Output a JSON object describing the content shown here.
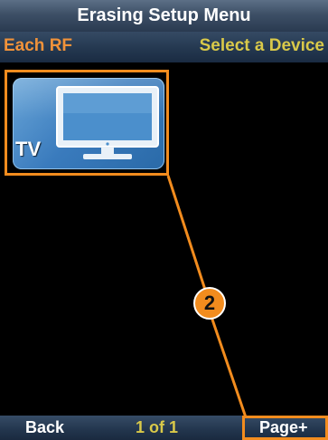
{
  "header": {
    "title": "Erasing Setup Menu"
  },
  "subheader": {
    "left_label": "Each RF",
    "right_label": "Select a Device"
  },
  "devices": [
    {
      "label": "TV",
      "icon": "tv-icon"
    }
  ],
  "footer": {
    "back_label": "Back",
    "page_indicator": "1 of 1",
    "page_next_label": "Page+"
  },
  "annotation": {
    "callout_number": "2"
  },
  "colors": {
    "accent_orange": "#f28c1e",
    "label_orange": "#f0923a",
    "label_yellow": "#d9c949",
    "bar_blue": "#243850",
    "tile_blue": "#3a7bbd"
  }
}
